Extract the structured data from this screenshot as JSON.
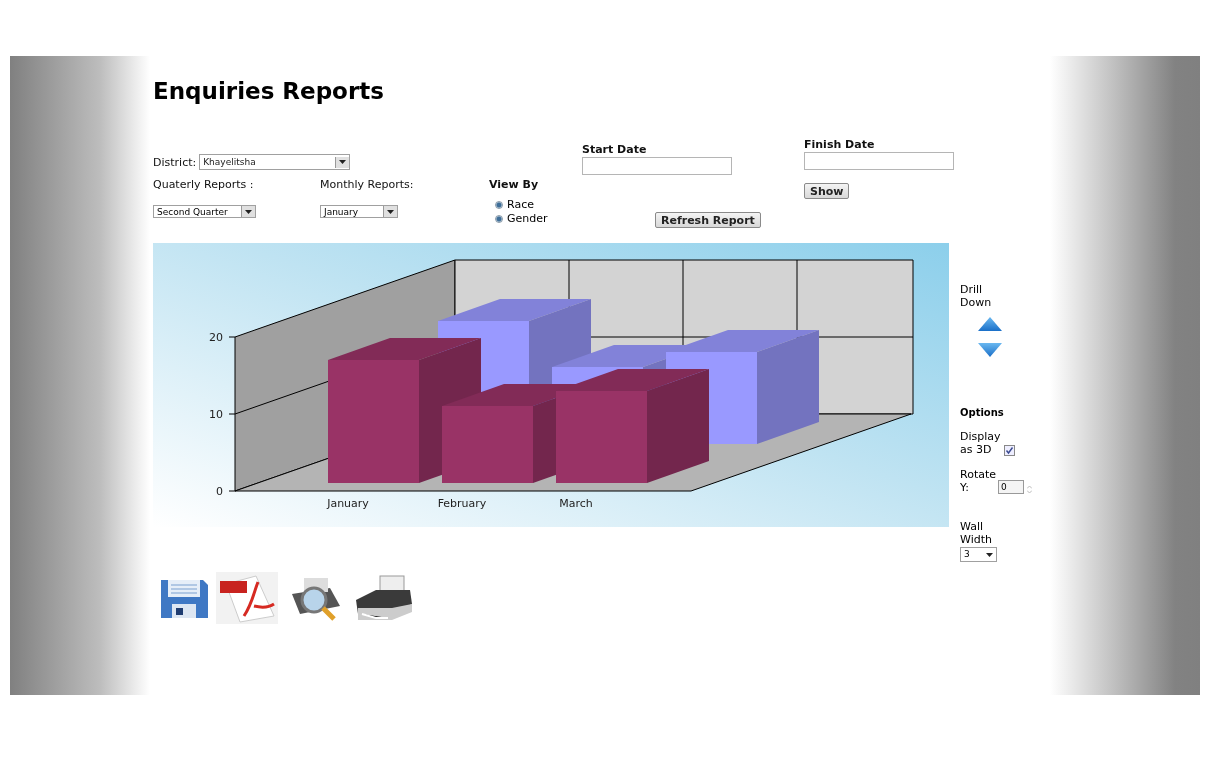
{
  "title": "Enquiries Reports",
  "district": {
    "label": "District:",
    "value": "Khayelitsha"
  },
  "start_date": {
    "label": "Start Date"
  },
  "finish_date": {
    "label": "Finish Date"
  },
  "show_button": "Show",
  "quarterly": {
    "label": "Quaterly Reports :",
    "value": "Second Quarter"
  },
  "monthly": {
    "label": "Monthly Reports:",
    "value": "January"
  },
  "view_by": {
    "label": "View By",
    "options": [
      {
        "label": "Race",
        "selected": true
      },
      {
        "label": "Gender",
        "selected": true
      }
    ]
  },
  "refresh_button": "Refresh Report",
  "chart": {
    "y_tick_labels": [
      "20",
      "10",
      "0"
    ],
    "categories": [
      "January",
      "February",
      "March"
    ]
  },
  "drill_down": {
    "label": "Drill Down"
  },
  "options": {
    "title": "Options",
    "display_3d": {
      "label": "Display as 3D",
      "checked": true
    },
    "rotate_y": {
      "label": "Rotate Y:",
      "value": "0"
    },
    "wall_width": {
      "label": "Wall Width",
      "value": "3"
    }
  },
  "toolbar": [
    {
      "kind": "save"
    },
    {
      "kind": "pdf"
    },
    {
      "kind": "preview"
    },
    {
      "kind": "print"
    }
  ]
}
